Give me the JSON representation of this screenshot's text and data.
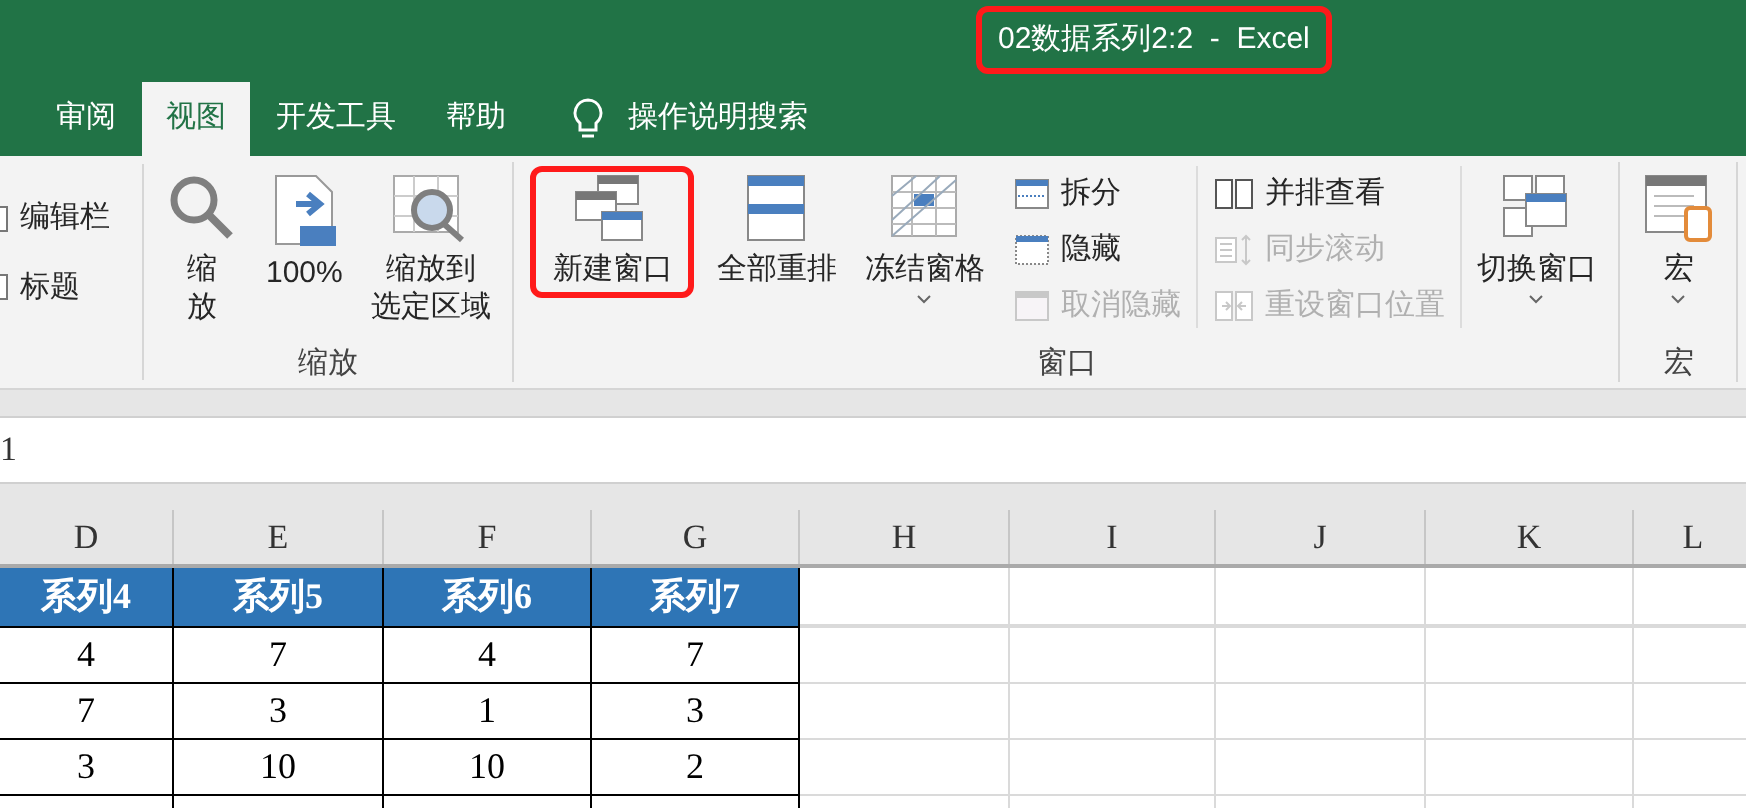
{
  "window": {
    "title": "02数据系列2:2  -  Excel",
    "highlighted": true
  },
  "tabs": [
    {
      "label": "审阅",
      "selected": false
    },
    {
      "label": "视图",
      "selected": true
    },
    {
      "label": "开发工具",
      "selected": false
    },
    {
      "label": "帮助",
      "selected": false
    }
  ],
  "search": {
    "label": "操作说明搜索"
  },
  "show_group": {
    "checkboxes": [
      {
        "label": "编辑栏",
        "checked": false
      },
      {
        "label": "标题",
        "checked": false
      }
    ]
  },
  "ribbon_groups": [
    {
      "label": "缩放",
      "columns": [
        {
          "kind": "large",
          "items": [
            {
              "label": "缩放",
              "disabled": false,
              "has_menu": false,
              "highlighted": false
            }
          ]
        },
        {
          "kind": "large",
          "items": [
            {
              "label": "100%",
              "disabled": false,
              "has_menu": false,
              "highlighted": false
            }
          ]
        },
        {
          "kind": "large",
          "items": [
            {
              "label": "缩放到选定区域",
              "disabled": false,
              "has_menu": false,
              "highlighted": false
            }
          ]
        }
      ]
    },
    {
      "label": "窗口",
      "columns": [
        {
          "kind": "large",
          "items": [
            {
              "label": "新建窗口",
              "disabled": false,
              "has_menu": false,
              "highlighted": true
            }
          ]
        },
        {
          "kind": "large",
          "items": [
            {
              "label": "全部重排",
              "disabled": false,
              "has_menu": false,
              "highlighted": false
            }
          ]
        },
        {
          "kind": "large",
          "items": [
            {
              "label": "冻结窗格",
              "disabled": false,
              "has_menu": true,
              "highlighted": false
            }
          ]
        },
        {
          "kind": "small",
          "items": [
            {
              "label": "拆分",
              "disabled": false
            },
            {
              "label": "隐藏",
              "disabled": false
            },
            {
              "label": "取消隐藏",
              "disabled": true
            }
          ]
        },
        {
          "kind": "small",
          "items": [
            {
              "label": "并排查看",
              "disabled": false
            },
            {
              "label": "同步滚动",
              "disabled": true
            },
            {
              "label": "重设窗口位置",
              "disabled": true
            }
          ]
        },
        {
          "kind": "large",
          "items": [
            {
              "label": "切换窗口",
              "disabled": false,
              "has_menu": true,
              "highlighted": false
            }
          ]
        }
      ]
    },
    {
      "label": "宏",
      "columns": [
        {
          "kind": "large",
          "items": [
            {
              "label": "宏",
              "disabled": false,
              "has_menu": true,
              "highlighted": false
            }
          ]
        }
      ]
    }
  ],
  "formula_bar": {
    "value": "1"
  },
  "sheet": {
    "columns": [
      "D",
      "E",
      "F",
      "G",
      "H",
      "I",
      "J",
      "K",
      "L"
    ],
    "header_row": [
      "系列4",
      "系列5",
      "系列6",
      "系列7"
    ],
    "rows": [
      [
        "4",
        "7",
        "4",
        "7"
      ],
      [
        "7",
        "3",
        "1",
        "3"
      ],
      [
        "3",
        "10",
        "10",
        "2"
      ],
      []
    ]
  }
}
